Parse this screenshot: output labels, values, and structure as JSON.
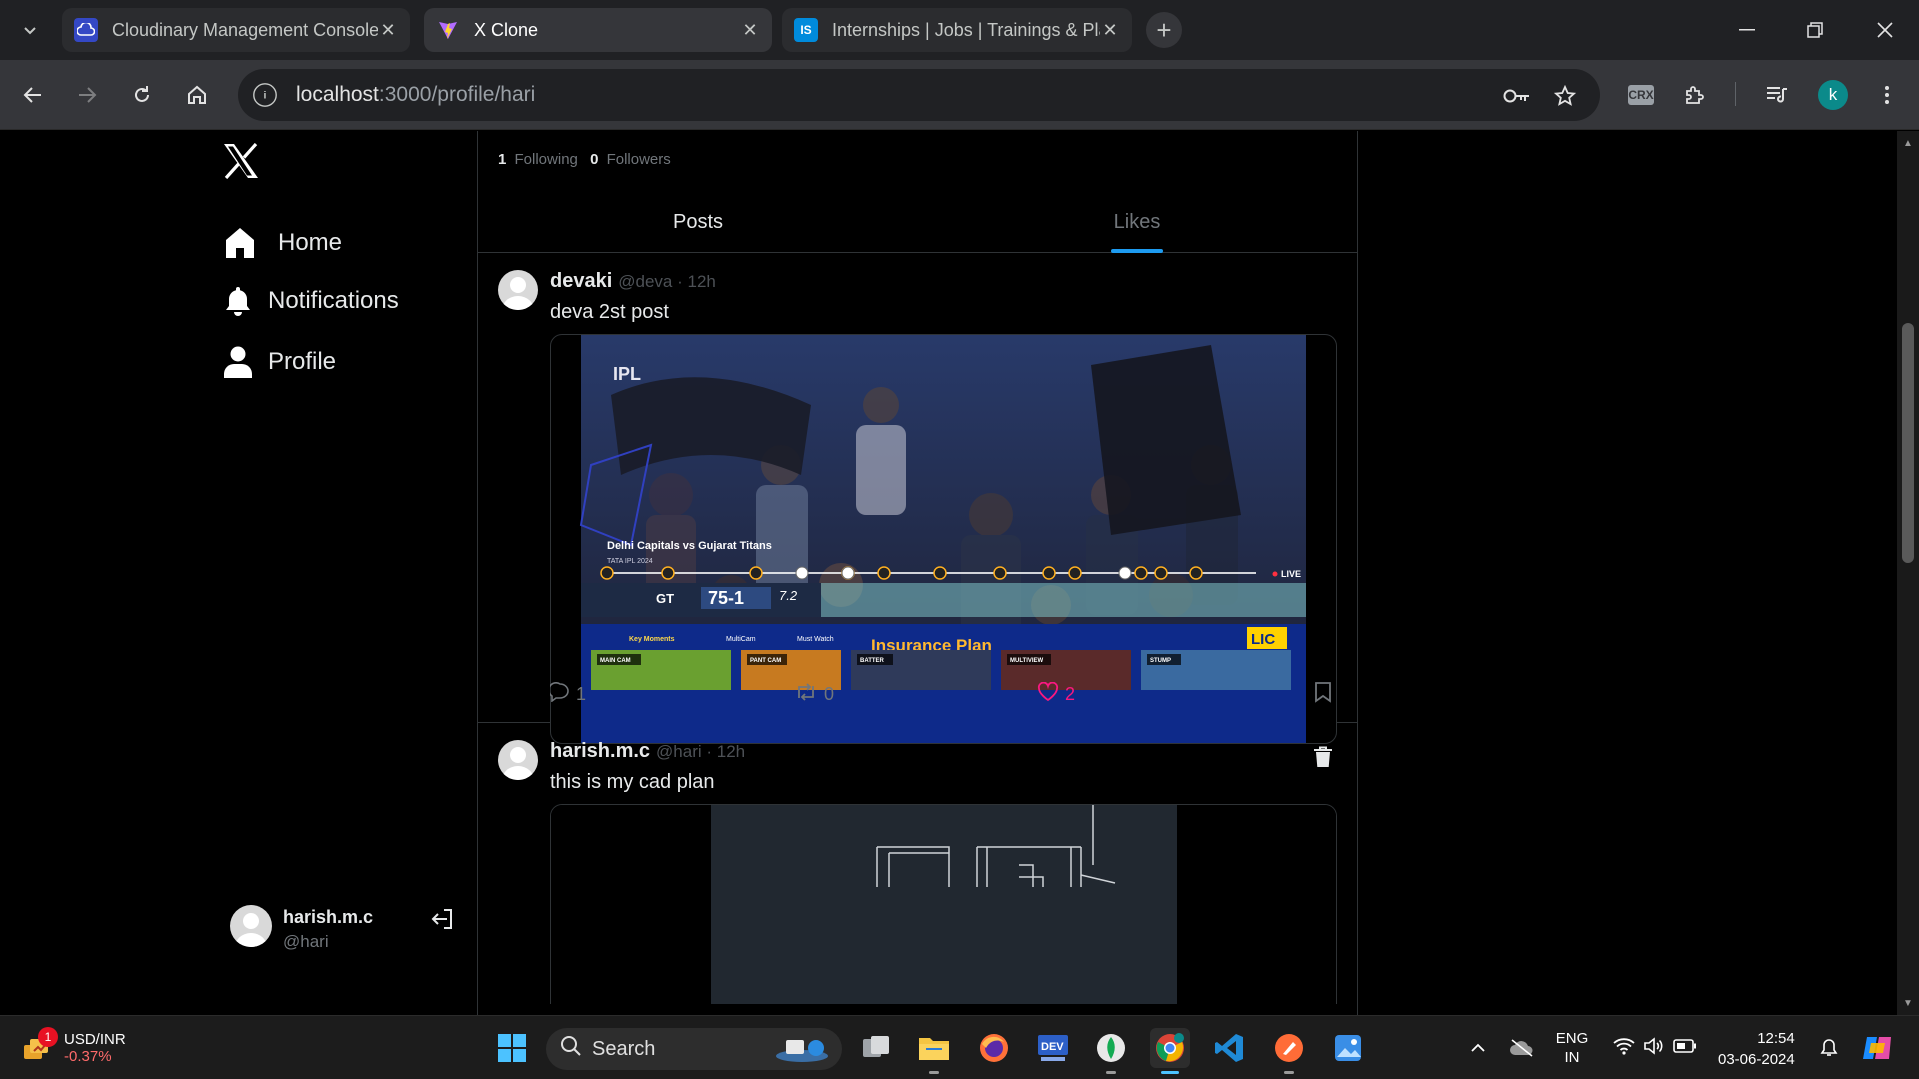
{
  "browser": {
    "tabs": [
      {
        "title": "Cloudinary Management Console",
        "active": false
      },
      {
        "title": "X Clone",
        "active": true
      },
      {
        "title": "Internships | Jobs | Trainings & Pla",
        "active": false
      }
    ],
    "url_host": "localhost",
    "url_path": ":3000/profile/hari",
    "profile_initial": "k",
    "crx_label": "CRX"
  },
  "sidebar": {
    "nav": [
      {
        "label": "Home",
        "icon": "home-icon"
      },
      {
        "label": "Notifications",
        "icon": "bell-icon"
      },
      {
        "label": "Profile",
        "icon": "user-icon"
      }
    ],
    "user": {
      "name": "harish.m.c",
      "handle": "@hari"
    }
  },
  "profile": {
    "following_count": "1",
    "following_label": "Following",
    "followers_count": "0",
    "followers_label": "Followers",
    "tabs": [
      {
        "label": "Posts",
        "active": false
      },
      {
        "label": "Likes",
        "active": true
      }
    ]
  },
  "posts": [
    {
      "name": "devaki",
      "meta": "@deva · 12h",
      "text": "deva 2st post",
      "media_caption": "Delhi Capitals vs Gujarat Titans",
      "media_sub": "TATA IPL 2024",
      "media_score": "75-1",
      "media_overs": "7.2",
      "media_team": "GT",
      "media_live": "LIVE",
      "media_ad": "Insurance Plan",
      "media_brand": "LIC",
      "media_buttons": [
        "Key Moments",
        "MultiCam",
        "Must Watch"
      ],
      "media_cams": [
        "MAIN CAM",
        "PANT CAM",
        "BATTER",
        "MULTIVIEW",
        "STUMP"
      ],
      "comments": "1",
      "reposts": "0",
      "likes": "2",
      "liked": true,
      "deletable": false
    },
    {
      "name": "harish.m.c",
      "meta": "@hari · 12h",
      "text": "this is my cad plan",
      "comments": "",
      "reposts": "",
      "likes": "",
      "liked": false,
      "deletable": true
    }
  ],
  "taskbar": {
    "widget_title": "USD/INR",
    "widget_value": "-0.37%",
    "widget_badge": "1",
    "search_label": "Search",
    "lang_top": "ENG",
    "lang_bottom": "IN",
    "time": "12:54",
    "date": "03-06-2024"
  },
  "colors": {
    "accent": "#1d9bf0",
    "like": "#f91880",
    "background": "#000000",
    "border": "#2f3336"
  }
}
